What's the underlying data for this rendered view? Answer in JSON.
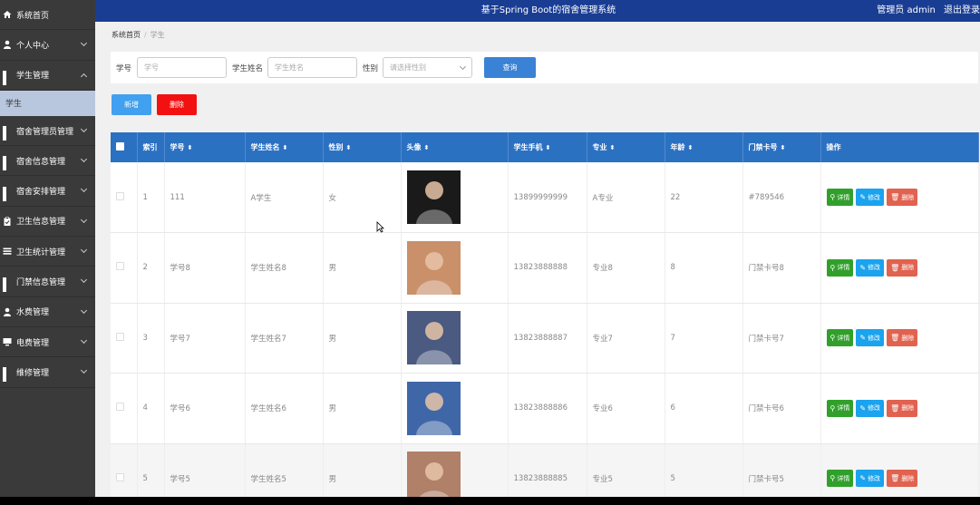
{
  "header": {
    "title": "基于Spring Boot的宿舍管理系统",
    "user": "管理员 admin",
    "logout": "退出登录"
  },
  "sidebar": {
    "items": [
      {
        "label": "系统首页",
        "icon": "home-icon"
      },
      {
        "label": "个人中心",
        "icon": "user-icon",
        "chev": "down"
      },
      {
        "label": "学生管理",
        "icon": "grid-icon",
        "chev": "up"
      },
      {
        "label": "宿舍管理员管理",
        "icon": "grid-icon",
        "chev": "down"
      },
      {
        "label": "宿舍信息管理",
        "icon": "grid-icon",
        "chev": "down"
      },
      {
        "label": "宿舍安排管理",
        "icon": "grid-icon",
        "chev": "down"
      },
      {
        "label": "卫生信息管理",
        "icon": "clipboard-icon",
        "chev": "down"
      },
      {
        "label": "卫生统计管理",
        "icon": "list-icon",
        "chev": "down"
      },
      {
        "label": "门禁信息管理",
        "icon": "grid-icon",
        "chev": "down"
      },
      {
        "label": "水费管理",
        "icon": "user-icon",
        "chev": "down"
      },
      {
        "label": "电费管理",
        "icon": "monitor-icon",
        "chev": "down"
      },
      {
        "label": "维修管理",
        "icon": "grid-icon",
        "chev": "down"
      }
    ],
    "sub": "学生"
  },
  "breadcrumb": {
    "home": "系统首页",
    "sep": "/",
    "current": "学生"
  },
  "search": {
    "id_label": "学号",
    "id_placeholder": "学号",
    "name_label": "学生姓名",
    "name_placeholder": "学生姓名",
    "gender_label": "性别",
    "gender_placeholder": "请选择性别",
    "query": "查询"
  },
  "actions": {
    "add": "新增",
    "delete": "删除"
  },
  "table": {
    "headers": [
      "索引",
      "学号",
      "学生姓名",
      "性别",
      "头像",
      "学生手机",
      "专业",
      "年龄",
      "门禁卡号",
      "操作"
    ],
    "row_buttons": {
      "detail": "详情",
      "edit": "修改",
      "remove": "删除"
    },
    "rows": [
      {
        "index": "1",
        "id": "111",
        "name": "A学生",
        "gender": "女",
        "phone": "13899999999",
        "major": "A专业",
        "age": "22",
        "card": "#789546",
        "avatar": "#1a1a1a"
      },
      {
        "index": "2",
        "id": "学号8",
        "name": "学生姓名8",
        "gender": "男",
        "phone": "13823888888",
        "major": "专业8",
        "age": "8",
        "card": "门禁卡号8",
        "avatar": "#c9906a"
      },
      {
        "index": "3",
        "id": "学号7",
        "name": "学生姓名7",
        "gender": "男",
        "phone": "13823888887",
        "major": "专业7",
        "age": "7",
        "card": "门禁卡号7",
        "avatar": "#4a5a80"
      },
      {
        "index": "4",
        "id": "学号6",
        "name": "学生姓名6",
        "gender": "男",
        "phone": "13823888886",
        "major": "专业6",
        "age": "6",
        "card": "门禁卡号6",
        "avatar": "#3f67a8"
      },
      {
        "index": "5",
        "id": "学号5",
        "name": "学生姓名5",
        "gender": "男",
        "phone": "13823888885",
        "major": "专业5",
        "age": "5",
        "card": "门禁卡号5",
        "avatar": "#b08068"
      }
    ]
  },
  "colors": {
    "header": "#1a3d94",
    "sidebar": "#3a3a3a",
    "table_head": "#2b71c2",
    "accent": "#3a82d6"
  }
}
